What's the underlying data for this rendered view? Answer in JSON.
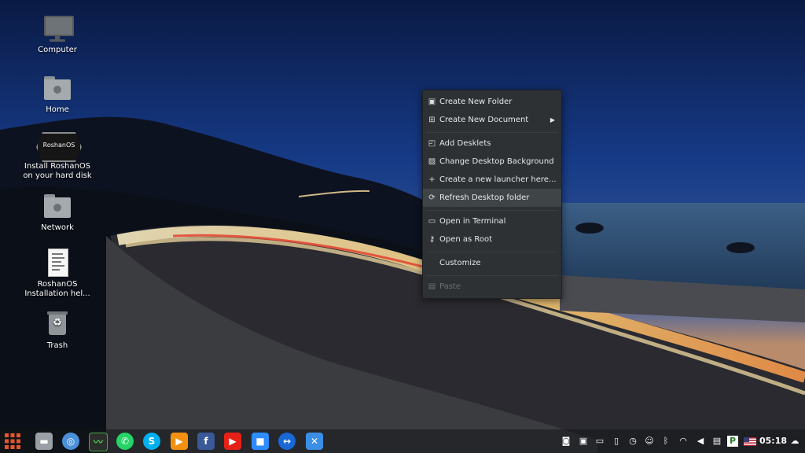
{
  "desktop": {
    "icons": [
      {
        "label": "Computer",
        "icon": "computer-icon"
      },
      {
        "label": "Home",
        "icon": "home-folder-icon"
      },
      {
        "label": "Install RoshanOS\non your hard disk",
        "icon": "roshanos-installer-icon",
        "badge_text": "RoshanOS"
      },
      {
        "label": "Network",
        "icon": "network-folder-icon"
      },
      {
        "label": "RoshanOS\nInstallation hel...",
        "icon": "document-icon"
      },
      {
        "label": "Trash",
        "icon": "trash-icon"
      }
    ]
  },
  "context_menu": {
    "items": [
      {
        "label": "Create New Folder",
        "icon": "folder-plus-icon"
      },
      {
        "label": "Create New Document",
        "icon": "document-plus-icon",
        "submenu": true
      },
      {
        "label": "Add Desklets",
        "icon": "desklet-icon"
      },
      {
        "label": "Change Desktop Background",
        "icon": "image-icon"
      },
      {
        "label": "Create a new launcher here...",
        "icon": "plus-icon"
      },
      {
        "label": "Refresh Desktop folder",
        "icon": "refresh-icon",
        "highlighted": true
      },
      {
        "label": "Open in Terminal",
        "icon": "terminal-icon"
      },
      {
        "label": "Open as Root",
        "icon": "key-icon"
      },
      {
        "label": "Customize",
        "icon": ""
      },
      {
        "label": "Paste",
        "icon": "clipboard-icon",
        "disabled": true
      }
    ]
  },
  "taskbar": {
    "apps": [
      {
        "name": "menu-button",
        "color": "#e8562a"
      },
      {
        "name": "files",
        "color": "#9aa0a6"
      },
      {
        "name": "browser",
        "color": "#4a90d9"
      },
      {
        "name": "system-monitor",
        "color": "#2b2f2b"
      },
      {
        "name": "whatsapp",
        "color": "#25d366"
      },
      {
        "name": "skype",
        "color": "#00aff0"
      },
      {
        "name": "media-player",
        "color": "#f29111"
      },
      {
        "name": "facebook",
        "color": "#3b5998"
      },
      {
        "name": "youtube",
        "color": "#e62117"
      },
      {
        "name": "zoom",
        "color": "#2d8cff"
      },
      {
        "name": "teamviewer",
        "color": "#1a68d6"
      },
      {
        "name": "network-app",
        "color": "#3a8ee6"
      }
    ],
    "tray": [
      "screenshot-icon",
      "radio-icon",
      "notes-icon",
      "phone-icon",
      "clock-history-icon",
      "accessibility-icon",
      "bluetooth-icon",
      "wifi-icon",
      "volume-icon",
      "clipboard-icon",
      "parking-icon",
      "us-flag-icon"
    ],
    "clock": "05:18"
  },
  "colors": {
    "menu_bg": "#2d3134",
    "menu_highlight": "#3f4447"
  }
}
